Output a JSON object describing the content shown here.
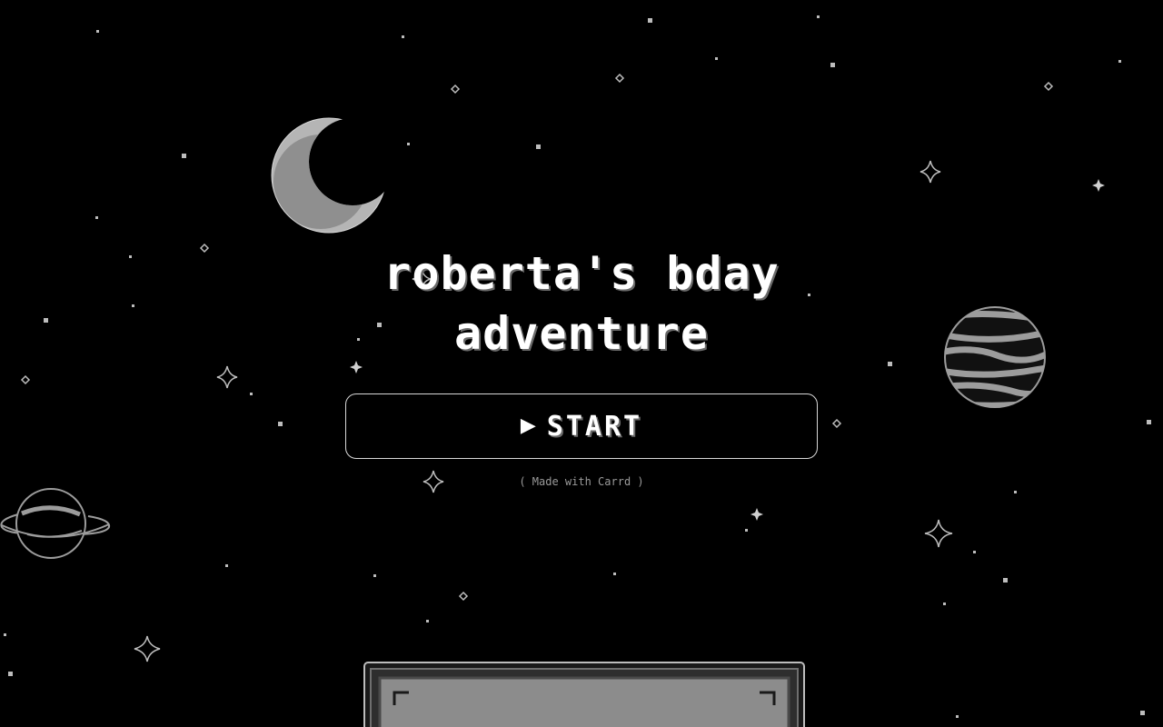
{
  "title": {
    "line1": "roberta's bday",
    "line2": "adventure"
  },
  "start_button": {
    "icon": "play-triangle-icon",
    "label": "START"
  },
  "credit": "( Made with Carrd )",
  "colors": {
    "background": "#000000",
    "text": "#ffffff",
    "moon": "#b5b5b5",
    "planet": "#9c9c9c",
    "star": "#bdbdbd",
    "dialog": "#8c8c8c"
  }
}
